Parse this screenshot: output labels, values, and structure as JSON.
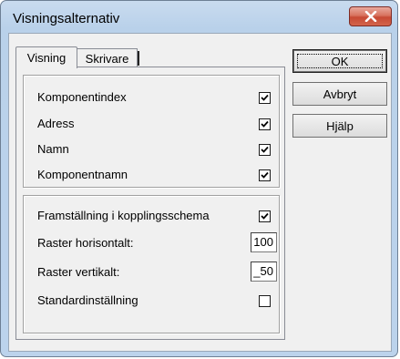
{
  "window": {
    "title": "Visningsalternativ"
  },
  "tabs": [
    {
      "label": "Visning",
      "active": true
    },
    {
      "label": "Skrivare",
      "active": false
    }
  ],
  "group1": {
    "items": [
      {
        "label": "Komponentindex",
        "checked": true
      },
      {
        "label": "Adress",
        "checked": true
      },
      {
        "label": "Namn",
        "checked": true
      },
      {
        "label": "Komponentnamn",
        "checked": true
      }
    ]
  },
  "group2": {
    "framstallning": {
      "label": "Framställning i kopplingsschema",
      "checked": true
    },
    "raster_h": {
      "label": "Raster horisontalt:",
      "value": "100"
    },
    "raster_v": {
      "label": "Raster vertikalt:",
      "value": "_50"
    },
    "standard": {
      "label": "Standardinställning",
      "checked": false
    }
  },
  "buttons": {
    "ok": "OK",
    "cancel": "Avbryt",
    "help_prefix": "H",
    "help_underlined": "j",
    "help_suffix": "älp"
  }
}
